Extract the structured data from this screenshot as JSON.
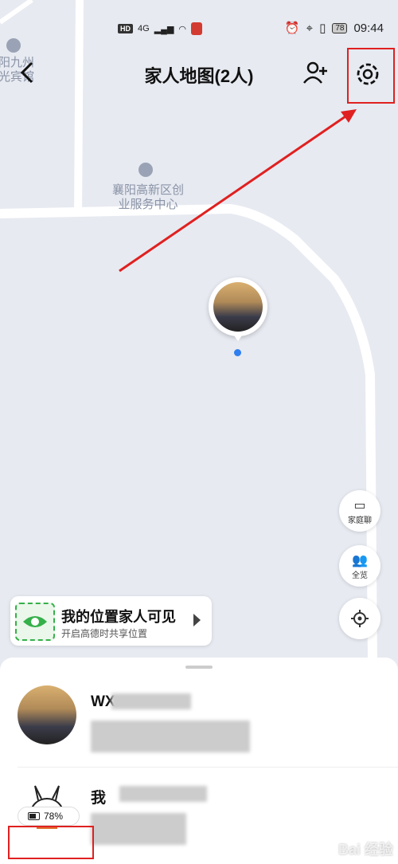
{
  "status_bar": {
    "network_label": "HD",
    "signal_label": "4G",
    "battery_level": "78",
    "time": "09:44"
  },
  "titlebar": {
    "title": "家人地图(2人)",
    "back_icon": "chevron-left-icon",
    "add_member_icon": "add-user-icon",
    "settings_icon": "gear-icon"
  },
  "map": {
    "poi_top_left": "阳九州\n光宾馆",
    "poi_center_line1": "襄阳高新区创",
    "poi_center_line2": "业服务中心"
  },
  "fabs": {
    "family_chat": "家庭聊",
    "overview": "全览",
    "locate_icon": "crosshair-icon"
  },
  "visibility_card": {
    "title": "我的位置家人可见",
    "subtitle": "开启高德时共享位置"
  },
  "members": [
    {
      "name": "WX",
      "battery": ""
    },
    {
      "name": "我",
      "battery": "78%"
    }
  ],
  "watermark": "Bai 经验",
  "colors": {
    "highlight": "#e02020",
    "accent_green": "#35b04a",
    "location_blue": "#2f7ff0"
  }
}
